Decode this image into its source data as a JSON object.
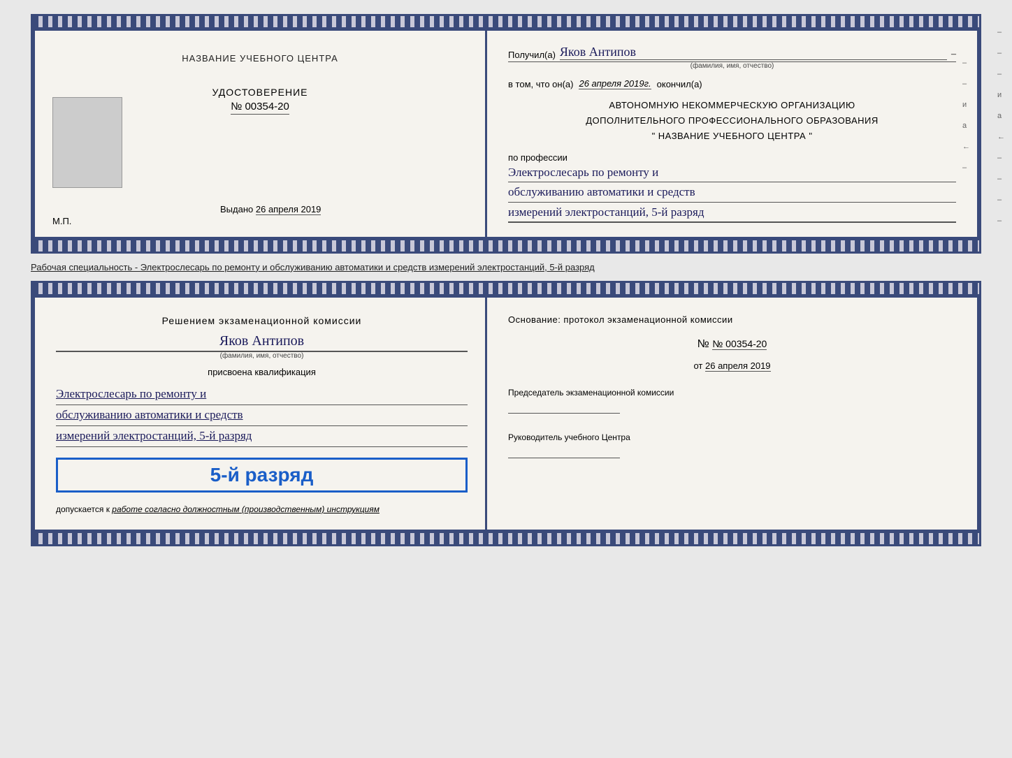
{
  "top_booklet": {
    "left": {
      "center_title": "НАЗВАНИЕ УЧЕБНОГО ЦЕНТРА",
      "udostoverenie": "УДОСТОВЕРЕНИЕ",
      "number": "№ 00354-20",
      "vydano_label": "Выдано",
      "vydano_date": "26 апреля 2019",
      "mp": "М.П."
    },
    "right": {
      "poluchil_label": "Получил(а)",
      "recipient_name": "Яков Антипов",
      "fio_label": "(фамилия, имя, отчество)",
      "vtom_prefix": "в том, что он(а)",
      "okончил": "окончил(а)",
      "date_completed": "26 апреля 2019г.",
      "org_line1": "АВТОНОМНУЮ НЕКОММЕРЧЕСКУЮ ОРГАНИЗАЦИЮ",
      "org_line2": "ДОПОЛНИТЕЛЬНОГО ПРОФЕССИОНАЛЬНОГО ОБРАЗОВАНИЯ",
      "org_line3": "\"  НАЗВАНИЕ УЧЕБНОГО ЦЕНТРА  \"",
      "po_professii": "по профессии",
      "profession_line1": "Электрослесарь по ремонту и",
      "profession_line2": "обслуживанию автоматики и средств",
      "profession_line3": "измерений электростанций, 5-й разряд"
    }
  },
  "middle_text": "Рабочая специальность - Электрослесарь по ремонту и обслуживанию автоматики и средств измерений электростанций, 5-й разряд",
  "bottom_booklet": {
    "left": {
      "decision": "Решением экзаменационной комиссии",
      "name": "Яков Антипов",
      "fio_label": "(фамилия, имя, отчество)",
      "prisvoena": "присвоена квалификация",
      "qual_line1": "Электрослесарь по ремонту и",
      "qual_line2": "обслуживанию автоматики и средств",
      "qual_line3": "измерений электростанций, 5-й разряд",
      "razryad_badge": "5-й разряд",
      "dopusk_prefix": "допускается к",
      "dopusk_italic": "работе согласно должностным (производственным) инструкциям"
    },
    "right": {
      "osnovaniye": "Основание: протокол экзаменационной комиссии",
      "number_label": "№ 00354-20",
      "ot_label": "от",
      "ot_date": "26 апреля 2019",
      "chairman_title": "Председатель экзаменационной комиссии",
      "director_title": "Руководитель учебного Центра"
    },
    "side_marks": [
      "–",
      "–",
      "–",
      "и",
      "а",
      "←",
      "–",
      "–",
      "–",
      "–"
    ]
  },
  "top_side_marks": [
    "–",
    "–",
    "и",
    "а",
    "←",
    "–"
  ]
}
